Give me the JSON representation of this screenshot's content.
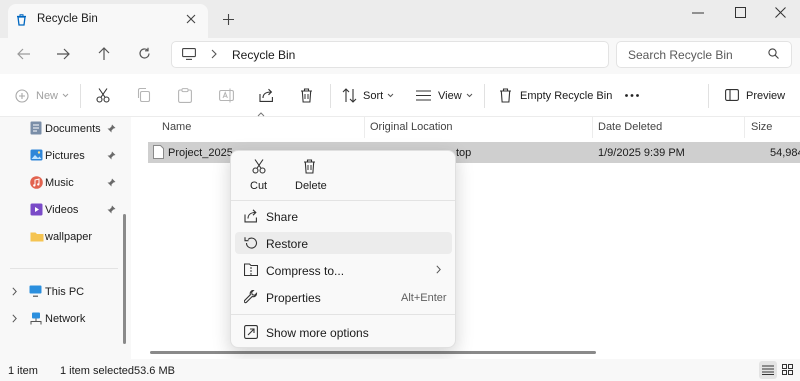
{
  "tab": {
    "title": "Recycle Bin"
  },
  "address": {
    "path": "Recycle Bin",
    "search_placeholder": "Search Recycle Bin"
  },
  "commands": {
    "new": "New",
    "sort": "Sort",
    "view": "View",
    "empty_recycle_bin": "Empty Recycle Bin",
    "preview": "Preview"
  },
  "sidebar": {
    "items": [
      {
        "label": "Documents",
        "icon": "documents-icon",
        "pinned": true
      },
      {
        "label": "Pictures",
        "icon": "pictures-icon",
        "pinned": true
      },
      {
        "label": "Music",
        "icon": "music-icon",
        "pinned": true
      },
      {
        "label": "Videos",
        "icon": "videos-icon",
        "pinned": true
      },
      {
        "label": "wallpaper",
        "icon": "folder-icon",
        "pinned": false
      }
    ],
    "tree": [
      {
        "label": "This PC",
        "icon": "pc-icon"
      },
      {
        "label": "Network",
        "icon": "network-icon"
      }
    ]
  },
  "columns": {
    "name": "Name",
    "original_location": "Original Location",
    "date_deleted": "Date Deleted",
    "size": "Size"
  },
  "file": {
    "name": "Project_2025.s",
    "original_location": "top",
    "date_deleted": "1/9/2025 9:39 PM",
    "size": "54,984"
  },
  "context_menu": {
    "cut": "Cut",
    "delete": "Delete",
    "share": "Share",
    "restore": "Restore",
    "compress": "Compress to...",
    "properties": "Properties",
    "properties_shortcut": "Alt+Enter",
    "show_more": "Show more options"
  },
  "status": {
    "count": "1 item",
    "selected": "1 item selected",
    "size": "53.6 MB"
  },
  "colors": {
    "accent": "#0067c0",
    "selection": "#cfcfcf",
    "menu_bg": "#f9f9f9"
  }
}
